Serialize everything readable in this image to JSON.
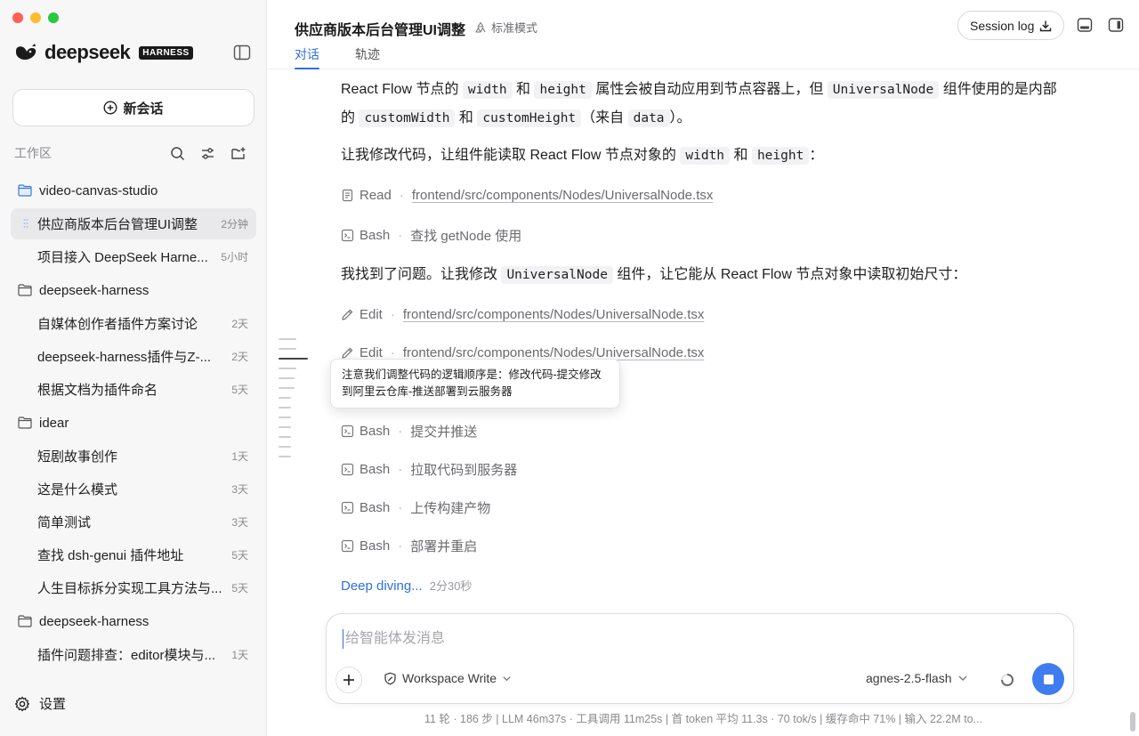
{
  "brand": {
    "name": "deepseek",
    "tag": "HARNESS"
  },
  "sidebar": {
    "new_chat": "新会话",
    "workspace_label": "工作区",
    "groups": [
      {
        "folder": "video-canvas-studio",
        "items": [
          {
            "title": "供应商版本后台管理UI调整",
            "time": "2分钟",
            "active": true
          },
          {
            "title": "项目接入 DeepSeek Harne...",
            "time": "5小时"
          }
        ]
      },
      {
        "folder": "deepseek-harness",
        "items": [
          {
            "title": "自媒体创作者插件方案讨论",
            "time": "2天"
          },
          {
            "title": "deepseek-harness插件与Z-...",
            "time": "2天"
          },
          {
            "title": "根据文档为插件命名",
            "time": "5天"
          }
        ]
      },
      {
        "folder": "idear",
        "items": [
          {
            "title": "短剧故事创作",
            "time": "1天"
          },
          {
            "title": "这是什么模式",
            "time": "3天"
          },
          {
            "title": "简单测试",
            "time": "3天"
          },
          {
            "title": "查找 dsh-genui 插件地址",
            "time": "5天"
          },
          {
            "title": "人生目标拆分实现工具方法与...",
            "time": "5天"
          }
        ]
      },
      {
        "folder": "deepseek-harness",
        "items": [
          {
            "title": "插件问题排查：editor模块与...",
            "time": "1天"
          }
        ]
      }
    ],
    "settings": "设置"
  },
  "header": {
    "title": "供应商版本后台管理UI调整",
    "mode": "标准模式",
    "tabs": [
      "对话",
      "轨迹"
    ],
    "session_log": "Session log"
  },
  "conversation": {
    "p1": {
      "t1": "React Flow 节点的 ",
      "c1": "width",
      "t2": " 和 ",
      "c2": "height",
      "t3": " 属性会被自动应用到节点容器上，但 ",
      "c3": "UniversalNode",
      "t4": " 组件使用的是内部的 ",
      "c4": "customWidth",
      "t5": " 和 ",
      "c5": "customHeight",
      "t6": "（来自 ",
      "c6": "data",
      "t7": "）。"
    },
    "p2": {
      "t1": "让我修改代码，让组件能读取 React Flow 节点对象的 ",
      "c1": "width",
      "t2": " 和 ",
      "c2": "height",
      "t3": "："
    },
    "p3": {
      "t1": "我找到了问题。让我修改 ",
      "c1": "UniversalNode",
      "t2": " 组件，让它能从 React Flow 节点对象中读取初始尺寸："
    },
    "tools": [
      {
        "name": "Read",
        "detail": "frontend/src/components/Nodes/UniversalNode.tsx",
        "icon": "file-icon"
      },
      {
        "name": "Bash",
        "detail": "查找 getNode 使用",
        "icon": "terminal-icon"
      },
      {
        "name": "Edit",
        "detail": "frontend/src/components/Nodes/UniversalNode.tsx",
        "icon": "pencil-icon"
      },
      {
        "name": "Edit",
        "detail": "frontend/src/components/Nodes/UniversalNode.tsx",
        "icon": "pencil-icon"
      },
      {
        "name": "Bash",
        "detail": "提交并推送",
        "icon": "terminal-icon"
      },
      {
        "name": "Bash",
        "detail": "拉取代码到服务器",
        "icon": "terminal-icon"
      },
      {
        "name": "Bash",
        "detail": "上传构建产物",
        "icon": "terminal-icon"
      },
      {
        "name": "Bash",
        "detail": "部署并重启",
        "icon": "terminal-icon"
      }
    ],
    "tooltip": "注意我们调整代码的逻辑顺序是：修改代码-提交修改到阿里云仓库-推送部署到云服务器",
    "deep_diving": "Deep diving...",
    "deep_diving_time": "2分30秒"
  },
  "composer": {
    "placeholder": "给智能体发消息",
    "workspace_mode": "Workspace Write",
    "model": "agnes-2.5-flash"
  },
  "status_bar": "11 轮 · 186 步   |   LLM 46m37s · 工具调用 11m25s   |   首 token 平均 11.3s · 70 tok/s   |   缓存命中 71%   |   输入 22.2M to...",
  "colors": {
    "accent": "#2f6fe0",
    "stop_button": "#3f7cf0",
    "active_item_bg": "#e9e9ec"
  }
}
